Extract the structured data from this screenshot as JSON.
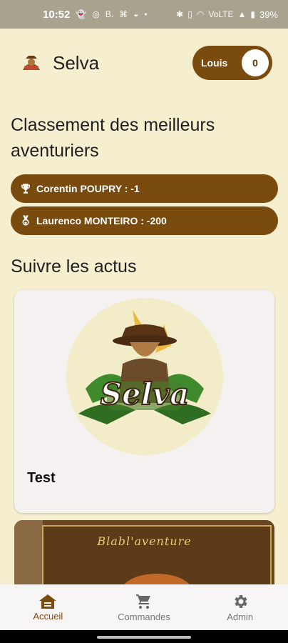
{
  "status_bar": {
    "time": "10:52",
    "left_icons": [
      "snapchat-icon",
      "whatsapp-icon",
      "booking-icon",
      "app-icon",
      "pot-icon",
      "dot-icon"
    ],
    "battery": "39%",
    "signal_label": "VoLTE"
  },
  "header": {
    "app_name": "Selva",
    "user_name": "Louis",
    "user_count": "0"
  },
  "ranking": {
    "title": "Classement des meilleurs aventuriers",
    "entries": [
      {
        "text": "Corentin POUPRY : -1",
        "icon": "trophy-icon"
      },
      {
        "text": "Laurenco MONTEIRO : -200",
        "icon": "medal-icon"
      }
    ]
  },
  "news": {
    "title": "Suivre les actus",
    "cards": [
      {
        "title": "Test",
        "image_text": "Selva"
      },
      {
        "image_text": "Blabl'aventure"
      }
    ]
  },
  "bottom_nav": {
    "items": [
      {
        "label": "Accueil",
        "icon": "home-icon",
        "active": true
      },
      {
        "label": "Commandes",
        "icon": "cart-icon",
        "active": false
      },
      {
        "label": "Admin",
        "icon": "gear-icon",
        "active": false
      }
    ]
  },
  "colors": {
    "background": "#f6efcf",
    "accent": "#7a4b0f",
    "status_bar": "#a9a28e"
  }
}
